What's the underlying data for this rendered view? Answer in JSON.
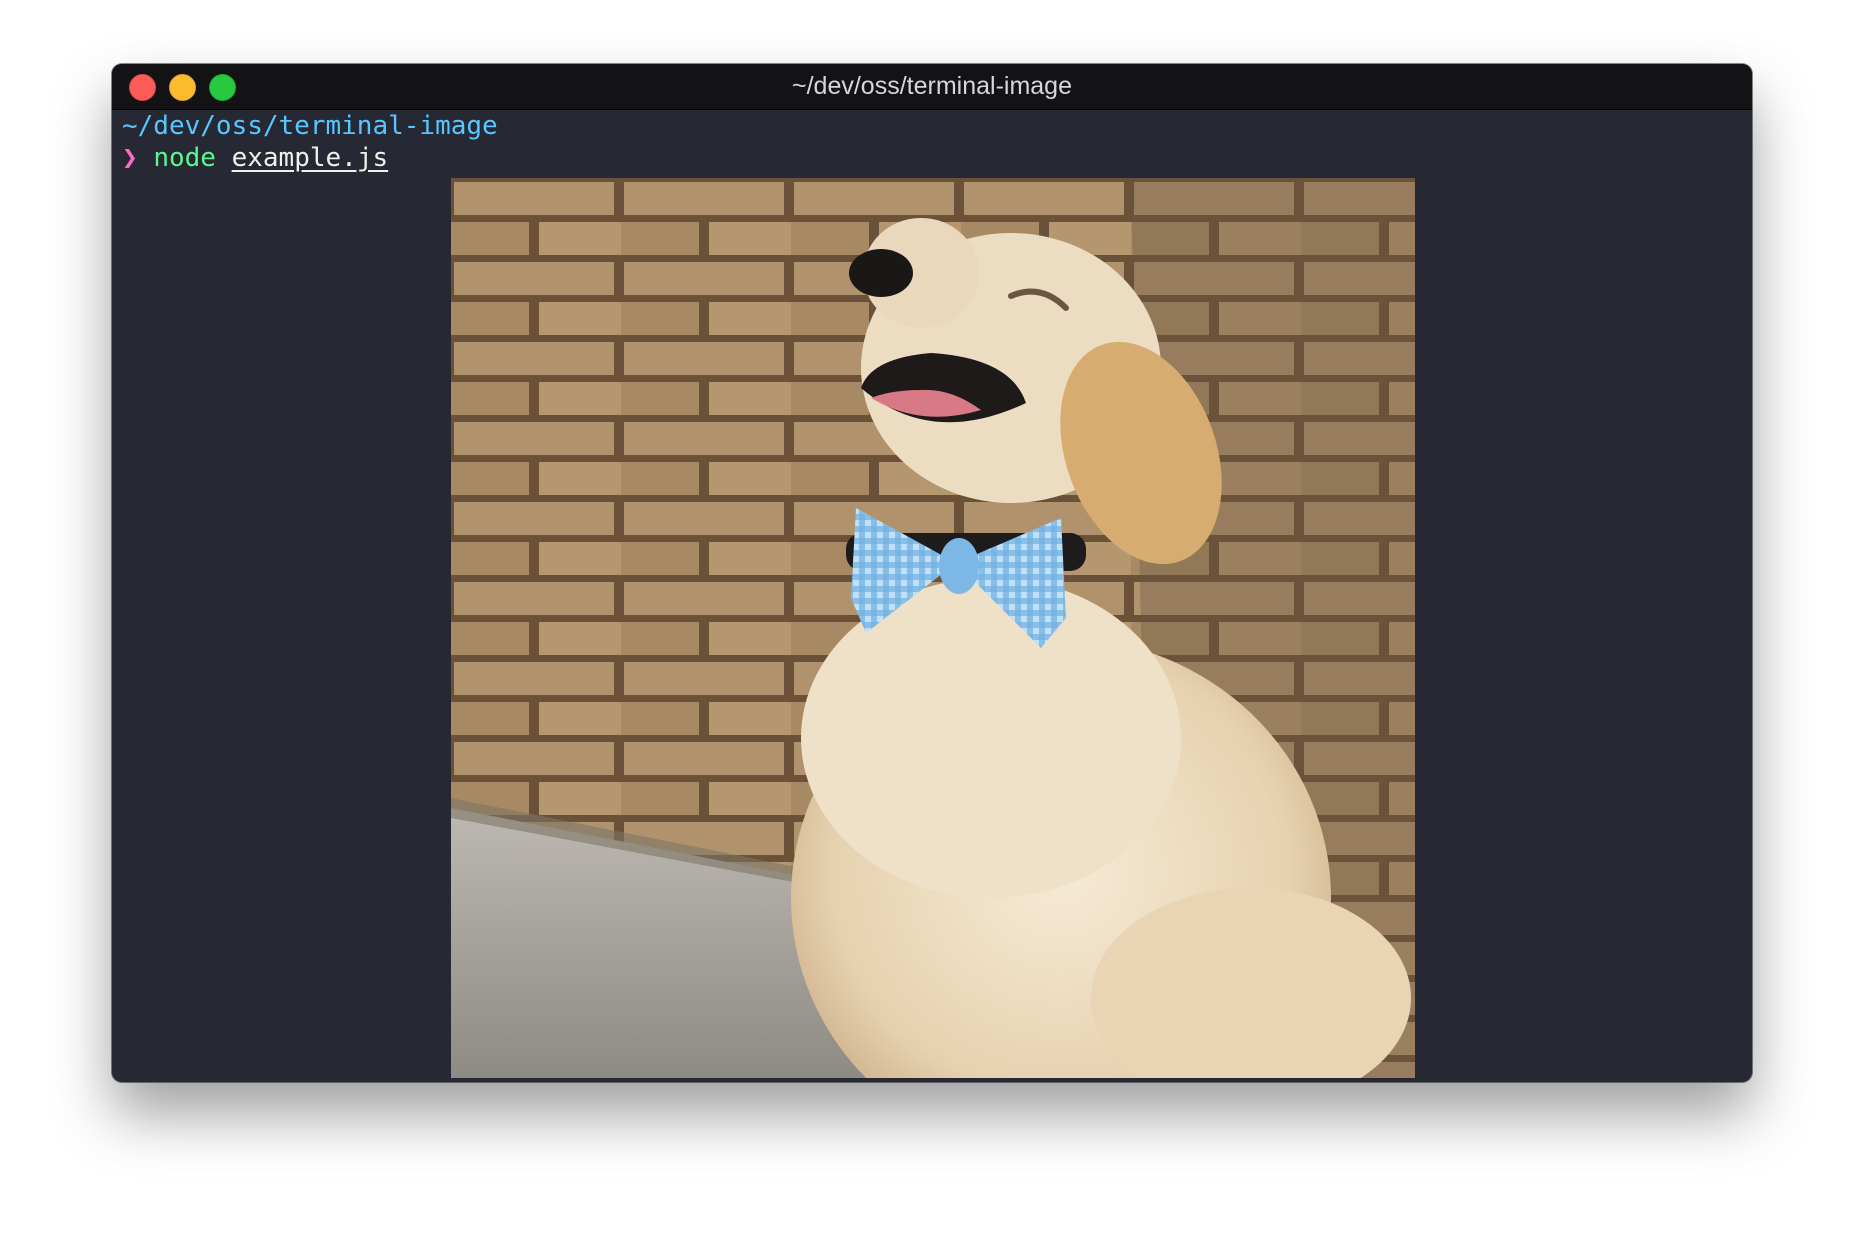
{
  "window": {
    "title": "~/dev/oss/terminal-image",
    "controls": {
      "close_color": "#fc5d57",
      "minimize_color": "#fdbc2e",
      "zoom_color": "#28c840"
    }
  },
  "terminal": {
    "cwd": "~/dev/oss/terminal-image",
    "prompt_symbol": "❯",
    "command": "node",
    "argument": "example.js",
    "colors": {
      "background": "#262834",
      "cwd": "#57c7ff",
      "prompt": "#ff6ac1",
      "command": "#5af78e",
      "argument": "#eff0eb"
    }
  },
  "output": {
    "image_subject": "golden retriever puppy wearing a blue gingham bow tie in front of a brick wall"
  }
}
